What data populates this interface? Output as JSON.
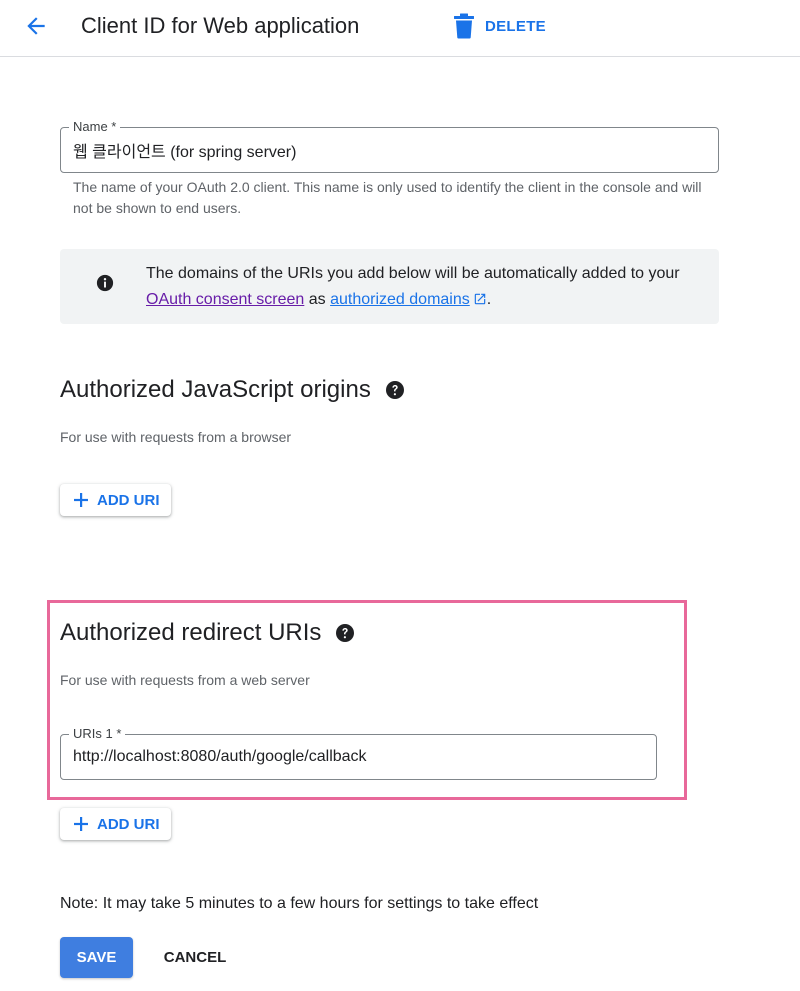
{
  "header": {
    "title": "Client ID for Web application",
    "delete_label": "DELETE"
  },
  "name_field": {
    "label": "Name *",
    "value": "웹 클라이언트 (for spring server)",
    "hint": "The name of your OAuth 2.0 client. This name is only used to identify the client in the console and will not be shown to end users."
  },
  "info": {
    "text_before": "The domains of the URIs you add below will be automatically added to your ",
    "link_consent": "OAuth consent screen",
    "text_mid": " as ",
    "link_domains": "authorized domains",
    "text_after": "."
  },
  "js_origins": {
    "title": "Authorized JavaScript origins",
    "subtitle": "For use with requests from a browser",
    "add_label": "ADD URI"
  },
  "redirect_uris": {
    "title": "Authorized redirect URIs",
    "subtitle": "For use with requests from a web server",
    "field_label": "URIs 1 *",
    "field_value": "http://localhost:8080/auth/google/callback",
    "add_label": "ADD URI"
  },
  "note": "Note: It may take 5 minutes to a few hours for settings to take effect",
  "actions": {
    "save_label": "SAVE",
    "cancel_label": "CANCEL"
  },
  "colors": {
    "accent": "#1a73e8",
    "save_button": "#3f7ee0",
    "visited_link": "#681da8",
    "highlight_border": "#e8689a",
    "info_background": "#f1f3f4"
  },
  "icons": {
    "back": "arrow-back-icon",
    "delete": "trash-icon",
    "info": "info-icon",
    "external": "external-link-icon",
    "help": "help-icon",
    "add": "plus-icon"
  }
}
